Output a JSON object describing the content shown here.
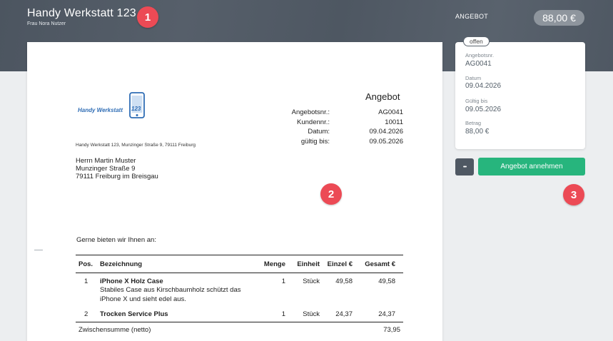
{
  "header": {
    "company_name": "Handy Werkstatt 123",
    "user_name": "Frau Nora Nutzer",
    "document_type": "ANGEBOT",
    "amount": "88,00 €"
  },
  "markers": [
    "1",
    "2",
    "3"
  ],
  "document": {
    "logo_text": "Handy Werkstatt",
    "logo_badge": "123",
    "sender_line": "Handy Werkstatt 123, Munzinger Straße 9, 79111 Freiburg",
    "recipient": {
      "name": "Herrn Martin Muster",
      "street": "Munzinger Straße 9",
      "city": "79111 Freiburg im Breisgau"
    },
    "heading": "Angebot",
    "meta": [
      {
        "label": "Angebotsnr.:",
        "value": "AG0041"
      },
      {
        "label": "Kundennr.:",
        "value": "10011"
      },
      {
        "label": "Datum:",
        "value": "09.04.2026"
      },
      {
        "label": "gültig bis:",
        "value": "09.05.2026"
      }
    ],
    "intro": "Gerne bieten wir Ihnen an:",
    "columns": {
      "pos": "Pos.",
      "desc": "Bezeichnung",
      "qty": "Menge",
      "unit": "Einheit",
      "single": "Einzel €",
      "total": "Gesamt €"
    },
    "items": [
      {
        "pos": "1",
        "name": "iPhone X Holz Case",
        "text": "Stabiles Case aus Kirschbaumholz schützt das iPhone X und sieht edel aus.",
        "qty": "1",
        "unit": "Stück",
        "single": "49,58",
        "total": "49,58"
      },
      {
        "pos": "2",
        "name": "Trocken Service Plus",
        "text": "",
        "qty": "1",
        "unit": "Stück",
        "single": "24,37",
        "total": "24,37"
      }
    ],
    "subtotal_label": "Zwischensumme (netto)",
    "subtotal_value": "73,95"
  },
  "sidebar": {
    "status": "offen",
    "fields": [
      {
        "label": "Angebotsnr.",
        "value": "AG0041"
      },
      {
        "label": "Datum",
        "value": "09.04.2026"
      },
      {
        "label": "Gültig bis",
        "value": "09.05.2026"
      },
      {
        "label": "Betrag",
        "value": "88,00 €"
      }
    ],
    "more_label": "•••",
    "accept_label": "Angebot annehmen"
  },
  "colors": {
    "header_bg": "#535c67",
    "marker": "#ec4a55",
    "accept": "#27b57d",
    "logo_blue": "#2f6db5"
  }
}
